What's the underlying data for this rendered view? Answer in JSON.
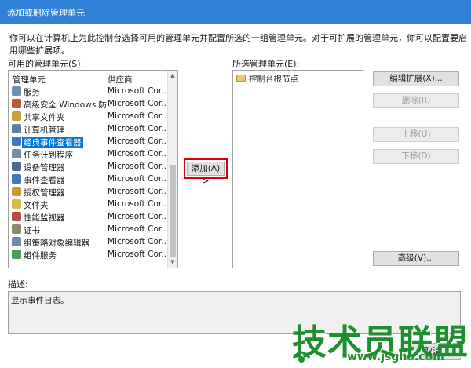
{
  "window": {
    "title": "添加或删除管理单元"
  },
  "intro_text": "你可以在计算机上为此控制台选择可用的管理单元并配置所选的一组管理单元。对于可扩展的管理单元，你可以配置要启用哪些扩展项。",
  "available": {
    "label": "可用的管理单元(S):",
    "col_name": "管理单元",
    "col_vendor": "供应商",
    "items": [
      {
        "name": "服务",
        "vendor": "Microsoft Cor...",
        "icon_color": "#6d8fb5"
      },
      {
        "name": "高级安全 Windows 防...",
        "vendor": "Microsoft Cor...",
        "icon_color": "#b85c3a"
      },
      {
        "name": "共享文件夹",
        "vendor": "Microsoft Cor...",
        "icon_color": "#c9a23a"
      },
      {
        "name": "计算机管理",
        "vendor": "Microsoft Cor...",
        "icon_color": "#5a7fa8"
      },
      {
        "name": "经典事件查看器",
        "vendor": "Microsoft Cor...",
        "icon_color": "#3c78c0",
        "selected": true
      },
      {
        "name": "任务计划程序",
        "vendor": "Microsoft Cor...",
        "icon_color": "#7a8c9e"
      },
      {
        "name": "设备管理器",
        "vendor": "Microsoft Cor...",
        "icon_color": "#4b6a8c"
      },
      {
        "name": "事件查看器",
        "vendor": "Microsoft Cor...",
        "icon_color": "#3c78c0"
      },
      {
        "name": "授权管理器",
        "vendor": "Microsoft Cor...",
        "icon_color": "#c49a2a"
      },
      {
        "name": "文件夹",
        "vendor": "Microsoft Cor...",
        "icon_color": "#e0b84a"
      },
      {
        "name": "性能监视器",
        "vendor": "Microsoft Cor...",
        "icon_color": "#c04848"
      },
      {
        "name": "证书",
        "vendor": "Microsoft Cor...",
        "icon_color": "#8a8a6a"
      },
      {
        "name": "组策略对象编辑器",
        "vendor": "Microsoft Cor...",
        "icon_color": "#6a8ab0"
      },
      {
        "name": "组件服务",
        "vendor": "Microsoft Cor...",
        "icon_color": "#4a9a5a"
      }
    ]
  },
  "add_button": "添加(A) >",
  "selected_panel": {
    "label": "所选管理单元(E):",
    "root_node": "控制台根节点"
  },
  "actions": {
    "edit_extensions": "编辑扩展(X)...",
    "remove": "删除(R)",
    "move_up": "上移(U)",
    "move_down": "下移(D)",
    "advanced": "高级(V)..."
  },
  "description": {
    "label": "描述:",
    "text": "显示事件日志。"
  },
  "footer": {
    "cancel": "取消"
  },
  "watermark": {
    "text": "技术员联盟",
    "url": "www.jsgho.com"
  },
  "colors": {
    "titlebar": "#2f80d6",
    "selection": "#0078d7",
    "highlight_border": "#d8000c",
    "watermark": "#1e8f2e"
  }
}
